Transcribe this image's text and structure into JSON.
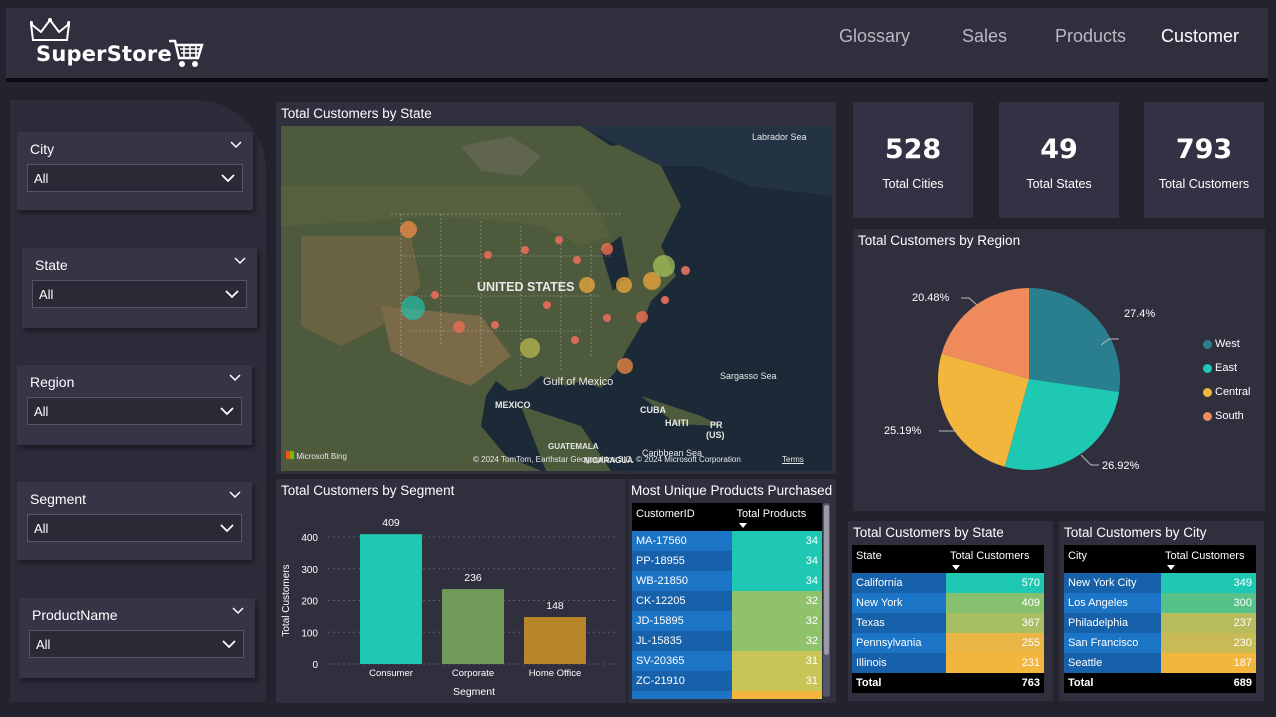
{
  "header": {
    "logo_text": "SuperStore",
    "nav": [
      "Glossary",
      "Sales",
      "Products",
      "Customer"
    ],
    "active": "Customer"
  },
  "filters": [
    {
      "label": "City",
      "value": "All"
    },
    {
      "label": "State",
      "value": "All"
    },
    {
      "label": "Region",
      "value": "All"
    },
    {
      "label": "Segment",
      "value": "All"
    },
    {
      "label": "ProductName",
      "value": "All"
    }
  ],
  "map": {
    "title": "Total Customers by State",
    "labels": {
      "labrador": "Labrador Sea",
      "us": "UNITED STATES",
      "gulf": "Gulf of Mexico",
      "sargasso": "Sargasso Sea",
      "mexico": "MEXICO",
      "cuba": "CUBA",
      "haiti": "HAITI",
      "pr": "PR",
      "pr_us": "(US)",
      "guatemala": "GUATEMALA",
      "nicaragua": "NICARAGUA",
      "caribbean": "Caribbean Sea",
      "bing": "Microsoft Bing",
      "copyright": "© 2024 TomTom, Earthstar Geographics SIO, © 2024 Microsoft Corporation",
      "terms": "Terms"
    }
  },
  "kpis": [
    {
      "value": "528",
      "label": "Total Cities"
    },
    {
      "value": "49",
      "label": "Total States"
    },
    {
      "value": "793",
      "label": "Total Customers"
    }
  ],
  "region_pie": {
    "title": "Total Customers by Region",
    "legend": [
      {
        "name": "West",
        "color": "#2a7f8f"
      },
      {
        "name": "East",
        "color": "#1ec8b2"
      },
      {
        "name": "Central",
        "color": "#f2b63d"
      },
      {
        "name": "South",
        "color": "#ef8a5c"
      }
    ],
    "labels": [
      "27.4%",
      "26.92%",
      "25.19%",
      "20.48%"
    ]
  },
  "chart_data": {
    "type": "bar",
    "title": "Total Customers by Segment",
    "categories": [
      "Consumer",
      "Corporate",
      "Home Office"
    ],
    "values": [
      409,
      236,
      148
    ],
    "xlabel": "Segment",
    "ylabel": "Total Customers",
    "ylim": [
      0,
      400
    ],
    "yticks": [
      0,
      100,
      200,
      300,
      400
    ],
    "colors": [
      "#1ec8b2",
      "#6f9a5a",
      "#b8862a"
    ]
  },
  "products_table": {
    "title": "Most Unique Products Purchased",
    "columns": [
      "CustomerID",
      "Total Products"
    ],
    "rows": [
      {
        "id": "MA-17560",
        "value": "34"
      },
      {
        "id": "PP-18955",
        "value": "34"
      },
      {
        "id": "WB-21850",
        "value": "34"
      },
      {
        "id": "CK-12205",
        "value": "32"
      },
      {
        "id": "JD-15895",
        "value": "32"
      },
      {
        "id": "JL-15835",
        "value": "32"
      },
      {
        "id": "SV-20365",
        "value": "31"
      },
      {
        "id": "ZC-21910",
        "value": "31"
      }
    ]
  },
  "state_table": {
    "title": "Total Customers by State",
    "columns": [
      "State",
      "Total Customers"
    ],
    "rows": [
      {
        "name": "California",
        "value": "570",
        "color": "#1ec8b2"
      },
      {
        "name": "New York",
        "value": "409",
        "color": "#86c06e"
      },
      {
        "name": "Texas",
        "value": "367",
        "color": "#a8be62"
      },
      {
        "name": "Pennsylvania",
        "value": "255",
        "color": "#e9b545"
      },
      {
        "name": "Illinois",
        "value": "231",
        "color": "#f2b63d"
      }
    ],
    "total_label": "Total",
    "total_value": "763"
  },
  "city_table": {
    "title": "Total Customers by City",
    "columns": [
      "City",
      "Total Customers"
    ],
    "rows": [
      {
        "name": "New York City",
        "value": "349",
        "color": "#1ec8b2"
      },
      {
        "name": "Los Angeles",
        "value": "300",
        "color": "#56c28a"
      },
      {
        "name": "Philadelphia",
        "value": "237",
        "color": "#b7bd5c"
      },
      {
        "name": "San Francisco",
        "value": "230",
        "color": "#c8ba55"
      },
      {
        "name": "Seattle",
        "value": "187",
        "color": "#f2b63d"
      }
    ],
    "total_label": "Total",
    "total_value": "689"
  }
}
